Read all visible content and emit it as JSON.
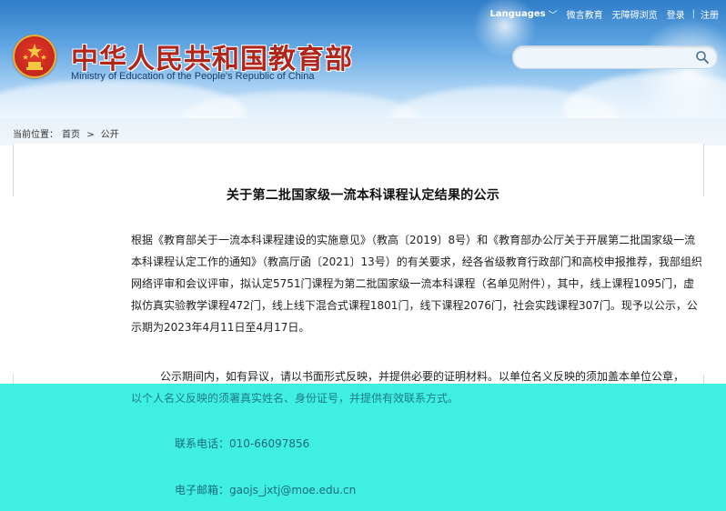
{
  "header": {
    "site_title": "中华人民共和国教育部",
    "site_subtitle": "Ministry of Education of the People's Republic of China",
    "nav": {
      "languages": "Languages",
      "weibo": "微言教育",
      "accessibility": "无障碍浏览",
      "login": "登录",
      "register": "注册"
    },
    "search": {
      "placeholder": "",
      "value": ""
    }
  },
  "breadcrumb": {
    "label": "当前位置：",
    "home": "首页",
    "separator": ">",
    "current": "公开"
  },
  "article": {
    "title": "关于第二批国家级一流本科课程认定结果的公示",
    "paragraph1": "根据《教育部关于一流本科课程建设的实施意见》（教高〔2019〕8号）和《教育部办公厅关于开展第二批国家级一流本科课程认定工作的通知》（教高厅函〔2021〕13号）的有关要求，经各省级教育行政部门和高校申报推荐，我部组织网络评审和会议评审，拟认定5751门课程为第二批国家级一流本科课程（名单见附件），其中，线上课程1095门，虚拟仿真实验教学课程472门，线上线下混合式课程1801门，线下课程2076门，社会实践课程307门。现予以公示，公示期为2023年4月11日至4月17日。",
    "paragraph2": "公示期间内，如有异议，请以书面形式反映，并提供必要的证明材料。以单位名义反映的须加盖本单位公章，",
    "paragraph2_cont": "以个人名义反映的须署真实姓名、身份证号，并提供有效联系方式。",
    "phone": "联系电话：010-66097856",
    "email": "电子邮箱：gaojs_jxtj@moe.edu.cn"
  },
  "colors": {
    "title_red": "#b1261b",
    "band_cyan": "#3ff0e0",
    "sky_blue": "#5fa5e2"
  }
}
